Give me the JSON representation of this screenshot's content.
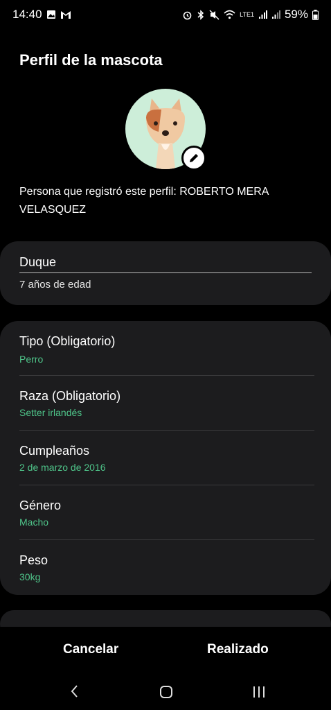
{
  "status_bar": {
    "time": "14:40",
    "battery": "59%",
    "network": "LTE1"
  },
  "page": {
    "title": "Perfil de la mascota",
    "registrant": "Persona que registró este perfil: ROBERTO MERA VELASQUEZ"
  },
  "pet": {
    "name": "Duque",
    "age": "7 años de edad"
  },
  "fields": [
    {
      "label": "Tipo (Obligatorio)",
      "value": "Perro"
    },
    {
      "label": "Raza (Obligatorio)",
      "value": "Setter irlandés"
    },
    {
      "label": "Cumpleaños",
      "value": "2 de marzo de 2016"
    },
    {
      "label": "Género",
      "value": "Macho"
    },
    {
      "label": "Peso",
      "value": "30kg"
    }
  ],
  "actions": {
    "cancel": "Cancelar",
    "done": "Realizado"
  },
  "colors": {
    "accent": "#4fc58a",
    "card": "#1c1c1e",
    "avatar_bg": "#cdeed9"
  }
}
